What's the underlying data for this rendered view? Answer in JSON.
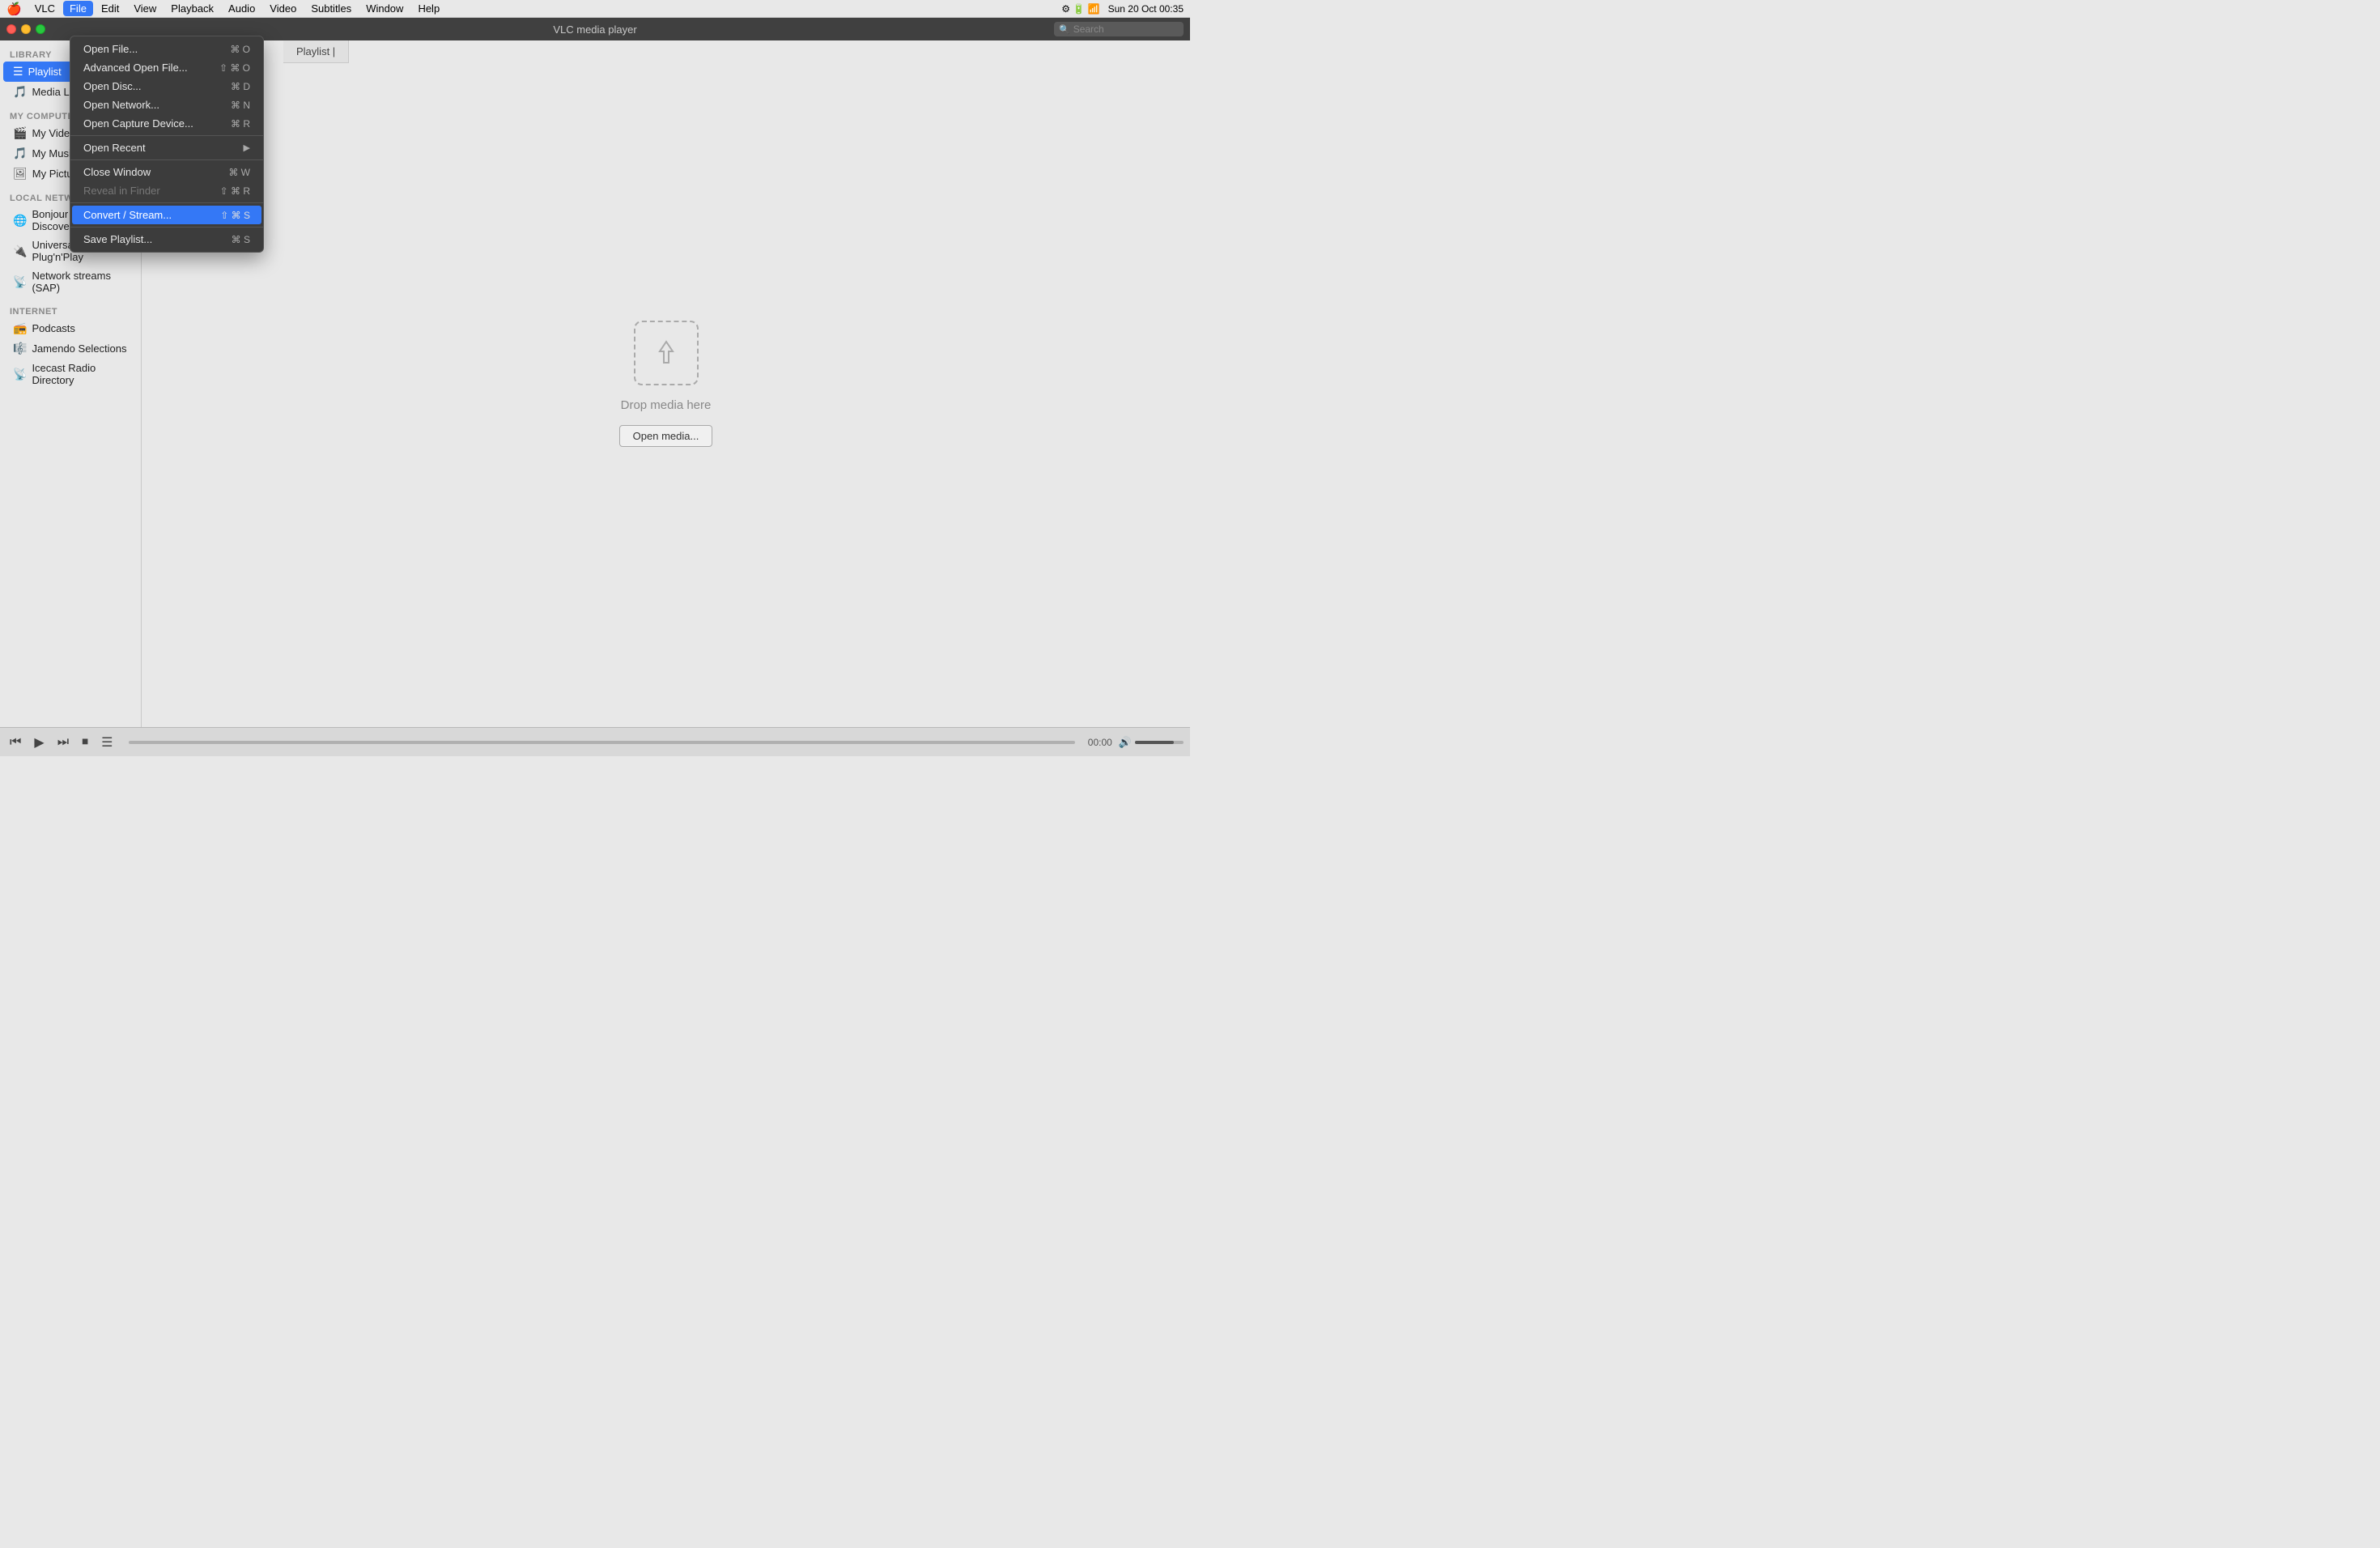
{
  "macos": {
    "menu_bar": {
      "apple": "🍎",
      "items": [
        {
          "label": "VLC",
          "active": false
        },
        {
          "label": "File",
          "active": true
        },
        {
          "label": "Edit",
          "active": false
        },
        {
          "label": "View",
          "active": false
        },
        {
          "label": "Playback",
          "active": false
        },
        {
          "label": "Audio",
          "active": false
        },
        {
          "label": "Video",
          "active": false
        },
        {
          "label": "Subtitles",
          "active": false
        },
        {
          "label": "Window",
          "active": false
        },
        {
          "label": "Help",
          "active": false
        }
      ],
      "right": {
        "datetime": "Sun 20 Oct  00:35"
      }
    }
  },
  "vlc": {
    "title": "VLC media player",
    "search_placeholder": "Search",
    "traffic_lights": {
      "red": "close",
      "yellow": "minimize",
      "green": "fullscreen"
    }
  },
  "sidebar": {
    "sections": [
      {
        "label": "LIBRARY",
        "items": [
          {
            "id": "playlist",
            "icon": "☰",
            "label": "Playlist",
            "active": true
          },
          {
            "id": "media-library",
            "icon": "🎵",
            "label": "Media Library",
            "active": false
          }
        ]
      },
      {
        "label": "MY COMPUTER",
        "items": [
          {
            "id": "my-videos",
            "icon": "🎬",
            "label": "My Videos",
            "active": false
          },
          {
            "id": "my-music",
            "icon": "🎵",
            "label": "My Music",
            "active": false
          },
          {
            "id": "my-pictures",
            "icon": "🖼",
            "label": "My Pictures",
            "active": false
          }
        ]
      },
      {
        "label": "LOCAL NETWORK",
        "items": [
          {
            "id": "bonjour",
            "icon": "🌐",
            "label": "Bonjour Network Discovery",
            "active": false
          },
          {
            "id": "upnp",
            "icon": "🔌",
            "label": "Universal Plug'n'Play",
            "active": false
          },
          {
            "id": "sap",
            "icon": "📡",
            "label": "Network streams (SAP)",
            "active": false
          }
        ]
      },
      {
        "label": "INTERNET",
        "items": [
          {
            "id": "podcasts",
            "icon": "📻",
            "label": "Podcasts",
            "active": false
          },
          {
            "id": "jamendo",
            "icon": "🎼",
            "label": "Jamendo Selections",
            "active": false
          },
          {
            "id": "icecast",
            "icon": "📡",
            "label": "Icecast Radio Directory",
            "active": false
          }
        ]
      }
    ]
  },
  "file_menu": {
    "items": [
      {
        "label": "Open File...",
        "shortcut": "⌘ O",
        "highlighted": false,
        "disabled": false,
        "has_submenu": false
      },
      {
        "label": "Advanced Open File...",
        "shortcut": "⇧ ⌘ O",
        "highlighted": false,
        "disabled": false,
        "has_submenu": false
      },
      {
        "label": "Open Disc...",
        "shortcut": "⌘ D",
        "highlighted": false,
        "disabled": false,
        "has_submenu": false
      },
      {
        "label": "Open Network...",
        "shortcut": "⌘ N",
        "highlighted": false,
        "disabled": false,
        "has_submenu": false
      },
      {
        "label": "Open Capture Device...",
        "shortcut": "⌘ R",
        "highlighted": false,
        "disabled": false,
        "has_submenu": false
      },
      {
        "separator": true
      },
      {
        "label": "Open Recent",
        "shortcut": "",
        "highlighted": false,
        "disabled": false,
        "has_submenu": true
      },
      {
        "separator": true
      },
      {
        "label": "Close Window",
        "shortcut": "⌘ W",
        "highlighted": false,
        "disabled": false,
        "has_submenu": false
      },
      {
        "label": "Reveal in Finder",
        "shortcut": "⇧ ⌘ R",
        "highlighted": false,
        "disabled": true,
        "has_submenu": false
      },
      {
        "separator": true
      },
      {
        "label": "Convert / Stream...",
        "shortcut": "⇧ ⌘ S",
        "highlighted": true,
        "disabled": false,
        "has_submenu": false
      },
      {
        "separator": true
      },
      {
        "label": "Save Playlist...",
        "shortcut": "⌘ S",
        "highlighted": false,
        "disabled": false,
        "has_submenu": false
      }
    ]
  },
  "main_content": {
    "drop_text": "Drop media here",
    "open_media_label": "Open media..."
  },
  "bottom_toolbar": {
    "rewind": "⏮",
    "play": "▶",
    "forward": "⏭",
    "stop": "⏹",
    "playlist": "☰",
    "time": "00:00",
    "volume_icon": "🔊"
  },
  "playlist_header": "Playlist |"
}
